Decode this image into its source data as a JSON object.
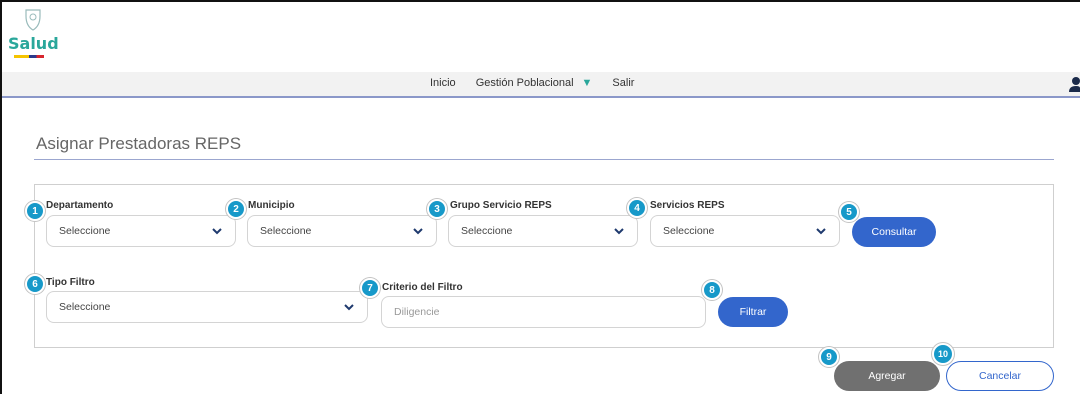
{
  "header": {
    "logo_text": "Salud"
  },
  "nav": {
    "items": [
      "Inicio",
      "Gestión Poblacional",
      "Salir"
    ]
  },
  "page": {
    "title": "Asignar Prestadoras REPS"
  },
  "filters": {
    "departamento": {
      "label": "Departamento",
      "value": "Seleccione"
    },
    "municipio": {
      "label": "Municipio",
      "value": "Seleccione"
    },
    "grupo_servicio": {
      "label": "Grupo Servicio REPS",
      "value": "Seleccione"
    },
    "servicios": {
      "label": "Servicios REPS",
      "value": "Seleccione"
    },
    "consultar_label": "Consultar",
    "tipo_filtro": {
      "label": "Tipo Filtro",
      "value": "Seleccione"
    },
    "criterio": {
      "label": "Criterio del Filtro",
      "placeholder": "Diligencie"
    },
    "filtrar_label": "Filtrar"
  },
  "actions": {
    "agregar_label": "Agregar",
    "cancelar_label": "Cancelar"
  },
  "badges": [
    "1",
    "2",
    "3",
    "4",
    "5",
    "6",
    "7",
    "8",
    "9",
    "10"
  ],
  "colors": {
    "primary": "#3366cc",
    "badge": "#1799c9",
    "brand": "#2aa79b"
  }
}
